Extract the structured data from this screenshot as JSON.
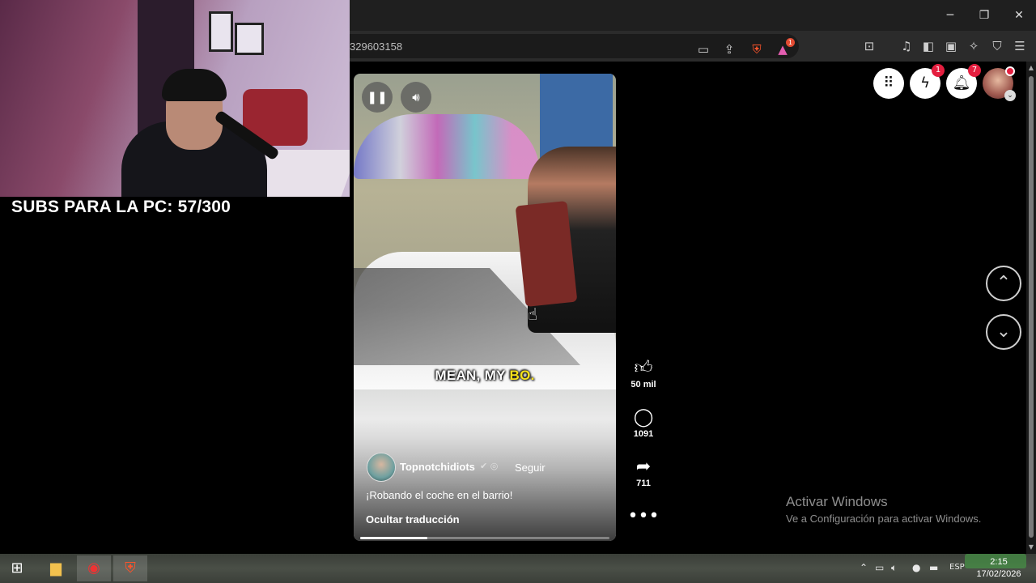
{
  "webcam": {
    "subs_text": "SUBS PARA LA PC: 57/300"
  },
  "browser": {
    "url_fragment": "329603158",
    "window_controls": {
      "minimize": "─",
      "restore": "❐",
      "close": "✕"
    },
    "shield_badge": "1"
  },
  "video": {
    "caption_main": "MEAN, MY ",
    "caption_highlight": "BO.",
    "author": "Topnotchidiots",
    "follow_label": "Seguir",
    "description": "¡Robando el coche en el barrio!",
    "hide_translation": "Ocultar traducción",
    "progress": 0.27
  },
  "actions": {
    "likes": "50 mil",
    "comments": "1091",
    "shares": "711"
  },
  "header_icons": {
    "messenger_badge": "1",
    "notifications_badge": "7"
  },
  "activate_windows": {
    "title": "Activar Windows",
    "subtitle": "Ve a Configuración para activar Windows."
  },
  "taskbar": {
    "language": "ESP",
    "time": "2:15",
    "date": "17/02/2026"
  }
}
